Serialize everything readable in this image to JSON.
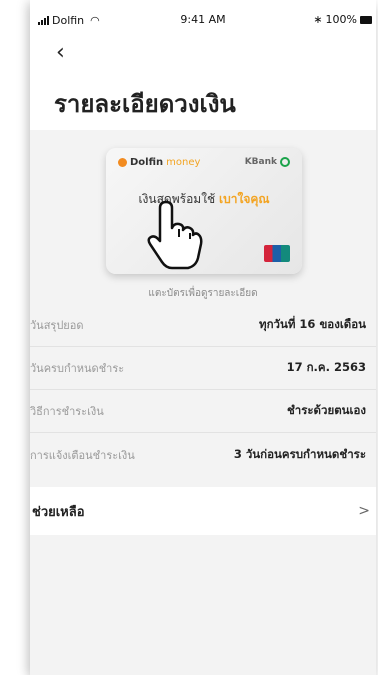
{
  "statusbar": {
    "carrier": "Dolfin",
    "time": "9:41 AM",
    "battery": "100%"
  },
  "header": {
    "back_icon": "chevron-left",
    "title": "รายละเอียดวงเงิน"
  },
  "card": {
    "brand_primary": "Dolfin",
    "brand_secondary": "money",
    "bank": "KBank",
    "tagline": "เงินสดพร้อมใช้",
    "tagline_highlight": "เบาใจคุณ",
    "hint": "แตะบัตรเพื่อดูรายละเอียด"
  },
  "details": [
    {
      "label": "วันสรุปยอด",
      "value": "ทุกวันที่ 16 ของเดือน"
    },
    {
      "label": "วันครบกำหนดชำระ",
      "value": "17 ก.ค. 2563"
    },
    {
      "label": "วิธีการชำระเงิน",
      "value": "ชำระด้วยตนเอง"
    },
    {
      "label": "การแจ้งเตือนชำระเงิน",
      "value": "3 วันก่อนครบกำหนดชำระ"
    }
  ],
  "help": {
    "label": "ช่วยเหลือ",
    "chevron": ">"
  },
  "colors": {
    "accent": "#f3a422",
    "brand_dot": "#f28b20",
    "bank_green": "#1aa34a",
    "background": "#f3f3f3"
  }
}
